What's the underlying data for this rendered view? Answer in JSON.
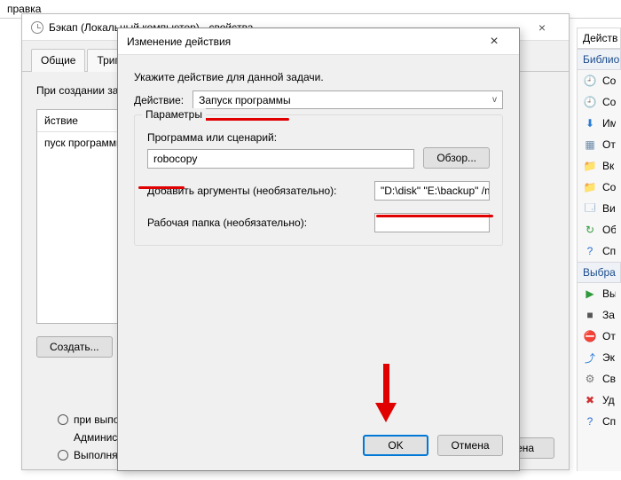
{
  "outer": {
    "menu_item": "правка"
  },
  "props_window": {
    "title": "Бэкап (Локальный компьютер) - свойства",
    "tabs": {
      "general": "Общие",
      "triggers": "Триггеры"
    },
    "hint": "При создании за",
    "table": {
      "header_action": "йствие",
      "row_action": "пуск программы"
    },
    "buttons": {
      "create": "Создать..."
    },
    "bottom": {
      "cancel": "мена"
    },
    "runas": {
      "line1": "при выполнени",
      "line2": "Администратор",
      "line3": "Выполнять"
    }
  },
  "edit_action": {
    "title": "Изменение действия",
    "hint": "Укажите действие для данной задачи.",
    "action_label": "Действие:",
    "action_value": "Запуск программы",
    "group_title": "Параметры",
    "program_label": "Программа или сценарий:",
    "program_value": "robocopy",
    "browse_label": "Обзор...",
    "addargs_label": "Добавить аргументы (необязательно):",
    "addargs_value": "\"D:\\disk\" \"E:\\backup\" /m",
    "startin_label": "Рабочая папка (необязательно):",
    "startin_value": "",
    "ok": "OK",
    "cancel": "Отмена"
  },
  "right_pane": {
    "header": "Действ",
    "section1": "Библио",
    "items1": [
      {
        "icon": "🕘",
        "label": "Со",
        "color": "#c88a00"
      },
      {
        "icon": "🕘",
        "label": "Со",
        "color": "#c88a00"
      },
      {
        "icon": "⬇",
        "label": "Им",
        "color": "#2a7bd6"
      },
      {
        "icon": "▦",
        "label": "От",
        "color": "#6b8aa8"
      },
      {
        "icon": "📁",
        "label": "Вк",
        "color": "#d9a82f"
      },
      {
        "icon": "📁",
        "label": "Со",
        "color": "#d9a82f"
      },
      {
        "icon": "🗔",
        "label": "Ви",
        "color": "#4a7db3"
      },
      {
        "icon": "↻",
        "label": "Об",
        "color": "#2e9a3a"
      },
      {
        "icon": "?",
        "label": "Сп",
        "color": "#2a6fd6"
      }
    ],
    "section2": "Выбра",
    "items2": [
      {
        "icon": "▶",
        "label": "Вы",
        "color": "#2e9a3a"
      },
      {
        "icon": "■",
        "label": "За",
        "color": "#555"
      },
      {
        "icon": "⛔",
        "label": "От",
        "color": "#555"
      },
      {
        "icon": "⤴",
        "label": "Эк",
        "color": "#2a7bd6"
      },
      {
        "icon": "⚙",
        "label": "Св",
        "color": "#777"
      },
      {
        "icon": "✖",
        "label": "Уд",
        "color": "#d03030"
      },
      {
        "icon": "?",
        "label": "Сп",
        "color": "#2a6fd6"
      }
    ]
  }
}
